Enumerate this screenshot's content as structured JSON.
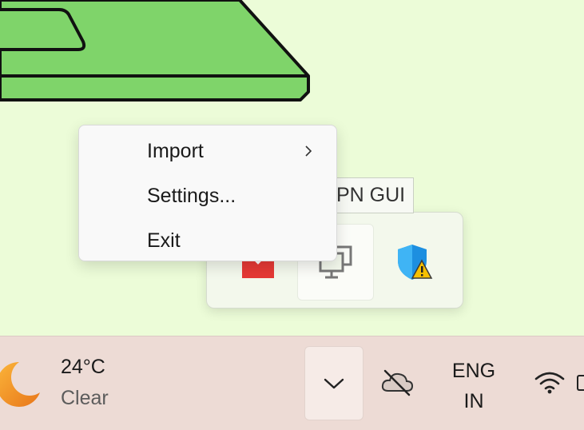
{
  "context_menu": {
    "items": [
      {
        "label": "Import",
        "has_submenu": true
      },
      {
        "label": "Settings..."
      },
      {
        "label": "Exit"
      }
    ]
  },
  "tooltip": {
    "text": "PN GUI"
  },
  "tray_flyout": {
    "icons": [
      "red-app-icon",
      "network-vpn-icon",
      "windows-security-warning-icon"
    ]
  },
  "taskbar": {
    "weather": {
      "temperature": "24°C",
      "condition": "Clear",
      "icon": "moon-icon"
    },
    "show_hidden_icons": "chevron-up-icon",
    "onedrive_icon": "cloud-offline-icon",
    "language": {
      "line1": "ENG",
      "line2": "IN"
    },
    "wifi_icon": "wifi-icon"
  },
  "colors": {
    "wallpaper": "#ecfcd8",
    "graphic_green": "#7fd46a",
    "taskbar": "#eddbd5",
    "security_blue": "#1d8fe0",
    "warning_yellow": "#f6c000"
  }
}
